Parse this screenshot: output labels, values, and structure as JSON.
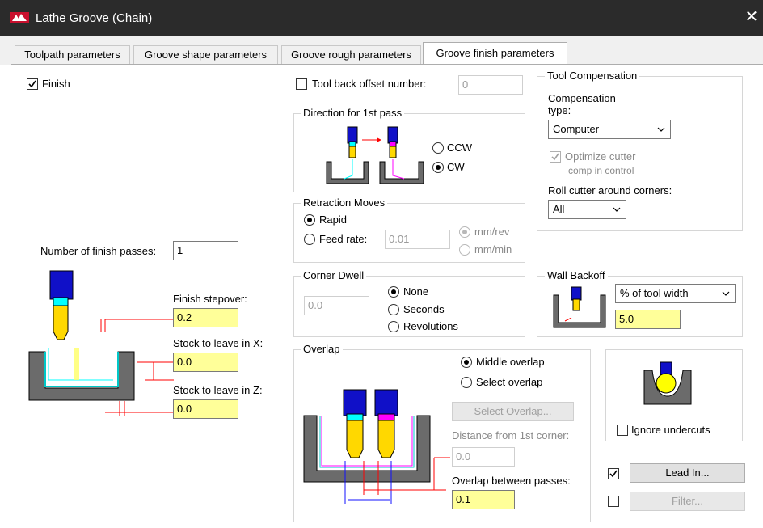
{
  "window": {
    "title": "Lathe Groove (Chain)",
    "close_glyph": "✕"
  },
  "tabs": [
    {
      "label": "Toolpath parameters",
      "active": false
    },
    {
      "label": "Groove shape parameters",
      "active": false
    },
    {
      "label": "Groove rough parameters",
      "active": false
    },
    {
      "label": "Groove finish parameters",
      "active": true
    }
  ],
  "finish": {
    "label": "Finish",
    "checked": true
  },
  "num_finish_passes": {
    "label": "Number of finish passes:",
    "value": "1"
  },
  "finish_stepover": {
    "label": "Finish stepover:",
    "value": "0.2"
  },
  "stock_x": {
    "label": "Stock to leave in X:",
    "value": "0.0"
  },
  "stock_z": {
    "label": "Stock to leave in Z:",
    "value": "0.0"
  },
  "tool_back_offset": {
    "label": "Tool back offset number:",
    "value": "0",
    "checked": false
  },
  "direction": {
    "title": "Direction for 1st pass",
    "ccw_label": "CCW",
    "cw_label": "CW",
    "selected": "CW"
  },
  "retraction": {
    "title": "Retraction Moves",
    "rapid_label": "Rapid",
    "feed_label": "Feed rate:",
    "feed_value": "0.01",
    "mm_rev": "mm/rev",
    "mm_min": "mm/min",
    "selected": "Rapid"
  },
  "corner_dwell": {
    "title": "Corner Dwell",
    "value": "0.0",
    "none_label": "None",
    "seconds_label": "Seconds",
    "revolutions_label": "Revolutions",
    "selected": "None"
  },
  "tool_comp": {
    "title": "Tool Compensation",
    "type_label_1": "Compensation",
    "type_label_2": "type:",
    "type_value": "Computer",
    "optimize_label": "Optimize cutter",
    "optimize_label_2": "comp in control",
    "optimize_checked": true,
    "roll_label": "Roll cutter around corners:",
    "roll_value": "All"
  },
  "wall_backoff": {
    "title": "Wall Backoff",
    "mode_value": "% of tool width",
    "value": "5.0"
  },
  "overlap": {
    "title": "Overlap",
    "middle_label": "Middle overlap",
    "select_label": "Select overlap",
    "selected": "Middle overlap",
    "select_button": "Select Overlap...",
    "distance_label": "Distance from 1st corner:",
    "distance_value": "0.0",
    "between_label": "Overlap between passes:",
    "between_value": "0.1"
  },
  "ignore_undercuts": {
    "label": "Ignore undercuts",
    "checked": false
  },
  "lead_in": {
    "label": "Lead In...",
    "checked": true
  },
  "filter": {
    "label": "Filter...",
    "checked": false
  },
  "icons": {
    "check": "✓",
    "chevron": "﹀",
    "close": "✕"
  },
  "colors": {
    "titlebar": "#2b2b2b",
    "highlight_input": "#ffff99",
    "tool_blue": "#1010c8",
    "tool_yellow": "#ffff00",
    "tool_cyan": "#00ffff",
    "tool_magenta": "#ff00ff",
    "part_gray": "#6b6b6b",
    "dim_red": "#ff0000"
  }
}
